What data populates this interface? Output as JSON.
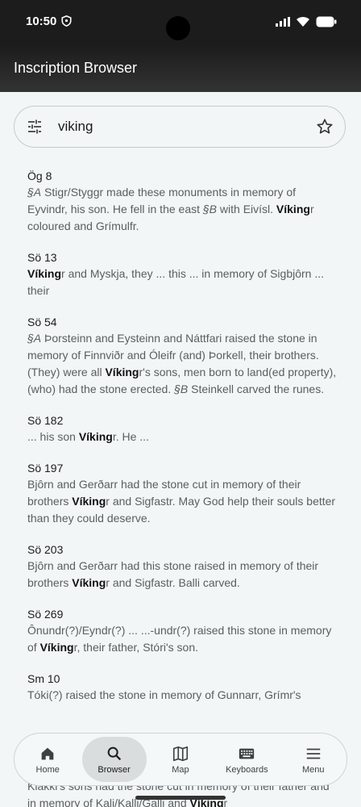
{
  "status": {
    "time": "10:50"
  },
  "appbar": {
    "title": "Inscription Browser"
  },
  "search": {
    "value": "viking"
  },
  "results": [
    {
      "id": "Ög 8",
      "html": "<i>§A</i> Stigr/Styggr made these monuments in memory of Eyvindr, his son. He fell in the east <i>§B</i> with Eivísl. <b>Víking</b>r coloured and Grímulfr."
    },
    {
      "id": "Sö 13",
      "html": "<b>Víking</b>r and Myskja, they ... this ... in memory of Sigbjôrn ... their"
    },
    {
      "id": "Sö 54",
      "html": "<i>§A</i> Þorsteinn and Eysteinn and Náttfari raised the stone in memory of Finnviðr and Óleifr (and) Þorkell, their brothers. (They) were all <b>Víking</b>r's sons, men born to land(ed property), (who) had the stone erected. <i>§B</i> Steinkell carved the runes."
    },
    {
      "id": "Sö 182",
      "html": "... his son <b>Víking</b>r. He ..."
    },
    {
      "id": "Sö 197",
      "html": "Bjôrn and Gerðarr had the stone cut in memory of their brothers <b>Víking</b>r and Sigfastr. May God help their souls better than they could deserve."
    },
    {
      "id": "Sö 203",
      "html": "Bjôrn and Gerðarr had this stone raised in memory of their brothers <b>Víking</b>r and Sigfastr. Balli carved."
    },
    {
      "id": "Sö 269",
      "html": "Ônundr(?)/Eyndr(?) ... ...-undr(?) raised this stone in memory of <b>Víking</b>r, their father, Stóri's son."
    },
    {
      "id": "Sm 10",
      "html": "Tóki(?) raised the stone in memory of Gunnarr, Grímr's"
    }
  ],
  "peek": {
    "html": "Klakki's sons had the stone cut in memory of their father and in memory of Kali/Kalli/Galli and <b>Víking</b>r"
  },
  "nav": {
    "home": "Home",
    "browser": "Browser",
    "map": "Map",
    "keyboards": "Keyboards",
    "menu": "Menu"
  },
  "icons": {
    "filter": "tune-icon",
    "favorite": "star-outline-icon",
    "home": "home-icon",
    "browser": "search-icon",
    "map": "map-icon",
    "keyboards": "keyboard-icon",
    "menu": "menu-icon"
  },
  "colors": {
    "background": "#f2f6f6",
    "appbar": "#1c1c1c",
    "nav_active": "#d9dddd"
  }
}
